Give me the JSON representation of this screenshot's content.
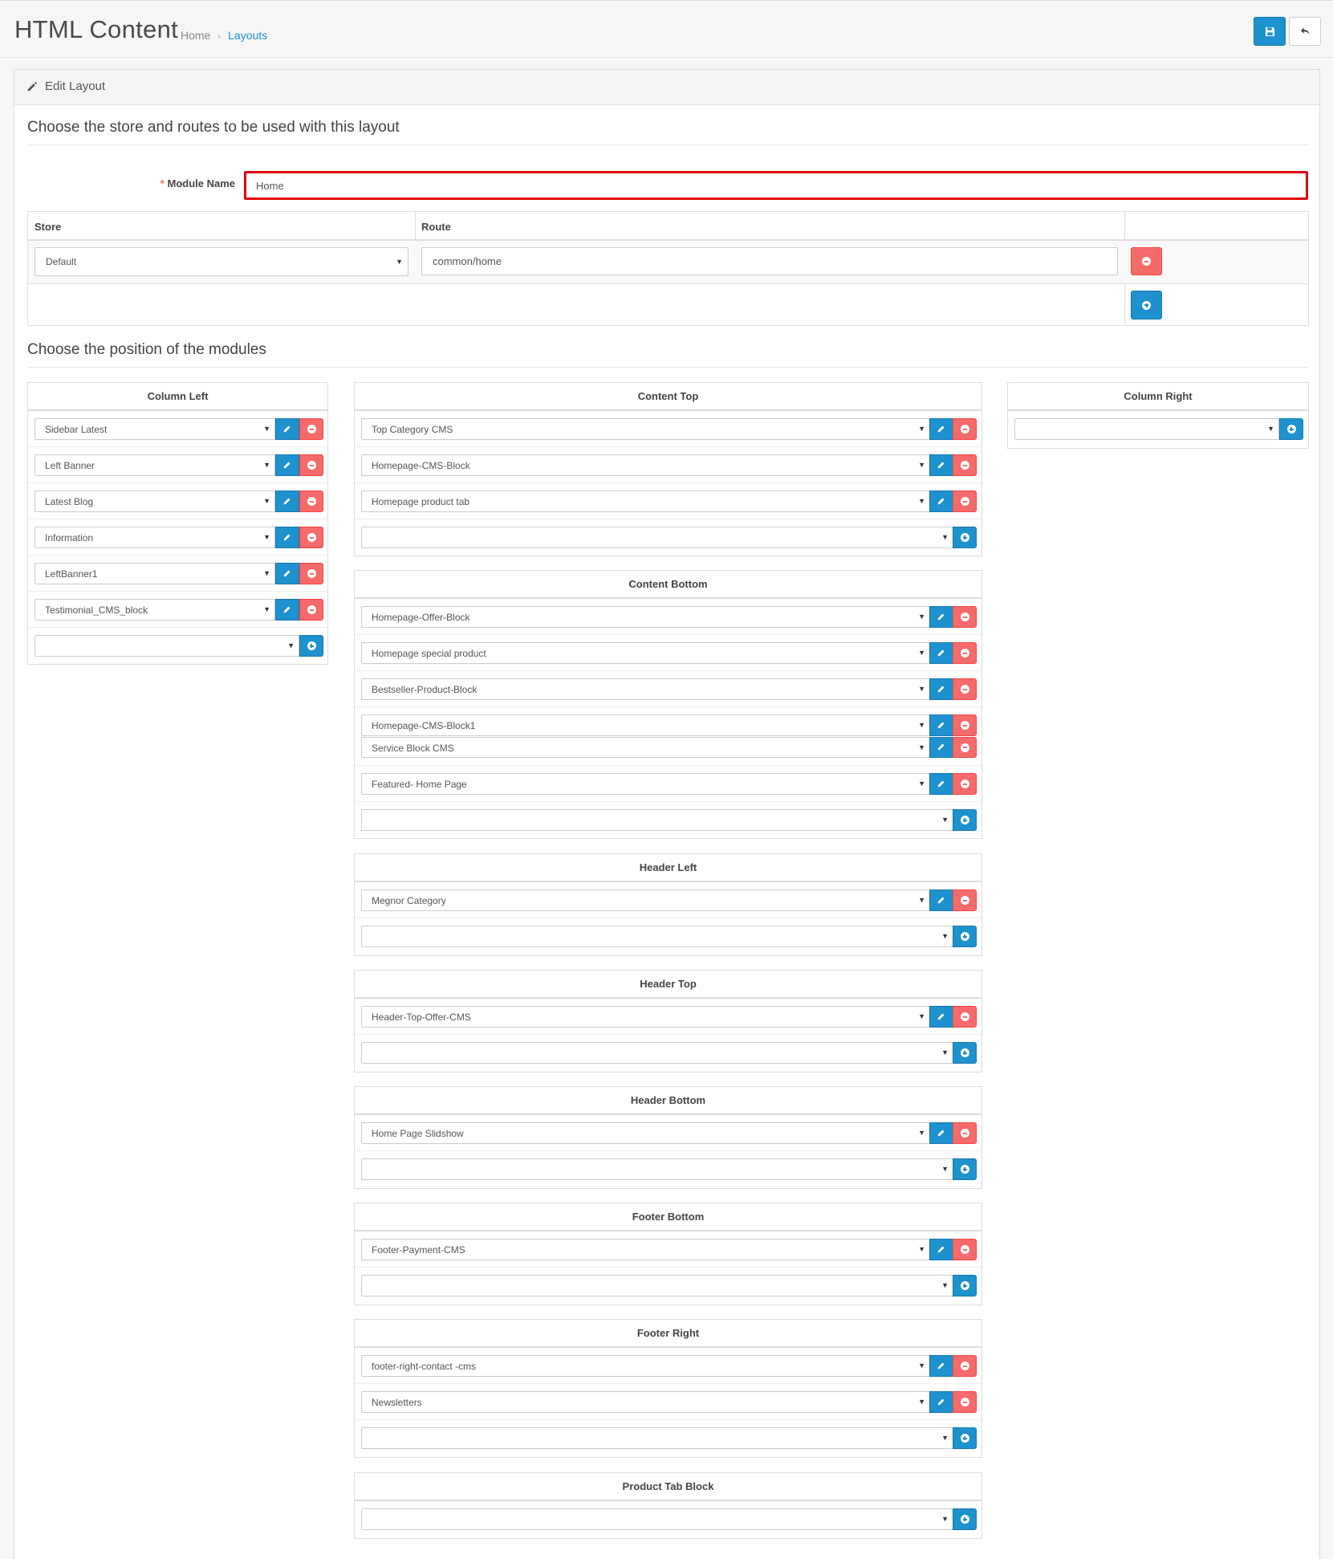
{
  "header": {
    "title": "HTML Content",
    "breadcrumb": {
      "home": "Home",
      "separator": "›",
      "current": "Layouts"
    }
  },
  "panel": {
    "title": "Edit Layout"
  },
  "legend_routes": "Choose the store and routes to be used with this layout",
  "form": {
    "module_name_label": "Module Name",
    "required_mark": "*",
    "module_name_value": "Home"
  },
  "route_table": {
    "store_header": "Store",
    "route_header": "Route",
    "rows": [
      {
        "store": "Default",
        "route": "common/home"
      }
    ]
  },
  "legend_positions": "Choose the position of the modules",
  "positions": {
    "column_left": {
      "title": "Column Left",
      "modules": [
        "Sidebar Latest",
        "Left Banner",
        "Latest Blog",
        "Information",
        "LeftBanner1",
        "Testimonial_CMS_block"
      ]
    },
    "column_right": {
      "title": "Column Right",
      "modules": []
    },
    "content_top": {
      "title": "Content Top",
      "modules": [
        "Top Category CMS",
        "Homepage-CMS-Block",
        "Homepage product tab"
      ]
    },
    "content_bottom": {
      "title": "Content Bottom",
      "modules": [
        "Homepage-Offer-Block",
        "Homepage special product",
        "Bestseller-Product-Block",
        "Homepage-CMS-Block1",
        "Service Block CMS",
        "Featured- Home Page"
      ]
    },
    "header_left": {
      "title": "Header Left",
      "modules": [
        "Megnor Category"
      ]
    },
    "header_top": {
      "title": "Header Top",
      "modules": [
        "Header-Top-Offer-CMS"
      ]
    },
    "header_bottom": {
      "title": "Header Bottom",
      "modules": [
        "Home Page Slidshow"
      ]
    },
    "footer_bottom": {
      "title": "Footer Bottom",
      "modules": [
        "Footer-Payment-CMS"
      ]
    },
    "footer_right": {
      "title": "Footer Right",
      "modules": [
        "footer-right-contact -cms",
        "Newsletters"
      ]
    },
    "product_tab_block": {
      "title": "Product Tab Block",
      "modules": []
    }
  },
  "icons": {
    "save": "save-icon",
    "back": "reply-icon",
    "edit": "pencil-icon",
    "remove": "minus-circle-icon",
    "add": "plus-circle-icon",
    "caret": "caret-down-icon"
  },
  "colors": {
    "primary": "#1e91cf",
    "danger": "#f56b6b",
    "highlight_border": "#e3000f",
    "link": "#1e91cf"
  }
}
